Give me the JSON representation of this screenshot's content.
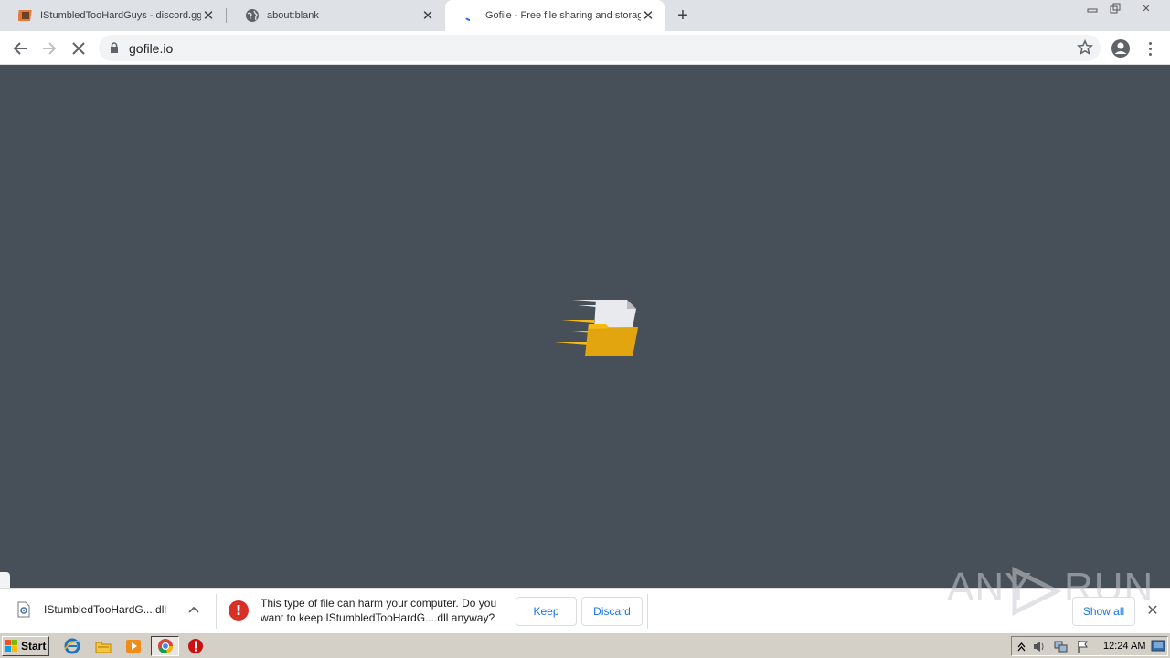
{
  "browser": {
    "tabs": [
      {
        "title": "IStumbledTooHardGuys - discord.gg",
        "favicon": "puzzle-favicon-icon",
        "active": false
      },
      {
        "title": "about:blank",
        "favicon": "globe-icon",
        "active": false
      },
      {
        "title": "Gofile - Free file sharing and storage",
        "favicon": "loading-spinner-icon",
        "active": true
      }
    ],
    "new_tab_label": "+",
    "address": "gofile.io",
    "accent_color": "#1a73e8"
  },
  "page": {
    "background_color": "#474f58",
    "loader_icon": "flying-folder-icon",
    "loader_colors": {
      "folder": "#f5b817",
      "paper": "#e8eaed"
    }
  },
  "download_bar": {
    "filename": "IStumbledTooHardG....dll",
    "warning_line1": "This type of file can harm your computer. Do you",
    "warning_line2": "want to keep IStumbledTooHardG....dll anyway?",
    "keep_label": "Keep",
    "discard_label": "Discard",
    "show_all_label": "Show all",
    "warning_color": "#d93025"
  },
  "watermark": {
    "text_left": "ANY",
    "text_right": "RUN"
  },
  "taskbar": {
    "start_label": "Start",
    "clock": "12:24 AM",
    "pinned": [
      "ie-icon",
      "explorer-folder-icon",
      "media-player-icon",
      "chrome-icon",
      "stop-icon"
    ]
  }
}
